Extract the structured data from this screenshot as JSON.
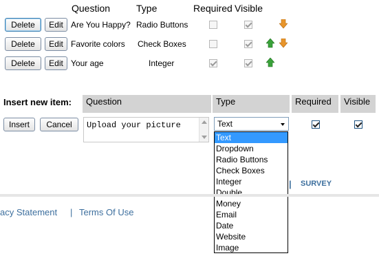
{
  "table": {
    "headers": {
      "question": "Question",
      "type": "Type",
      "required": "Required",
      "visible": "Visible"
    },
    "rows": [
      {
        "delete": "Delete",
        "edit": "Edit",
        "question": "Are You Happy?",
        "type": "Radio Buttons",
        "required": false,
        "visible": true,
        "up": false,
        "down": true
      },
      {
        "delete": "Delete",
        "edit": "Edit",
        "question": "Favorite colors",
        "type": "Check Boxes",
        "required": false,
        "visible": true,
        "up": true,
        "down": true
      },
      {
        "delete": "Delete",
        "edit": "Edit",
        "question": "Your age",
        "type": "Integer",
        "required": true,
        "visible": true,
        "up": true,
        "down": false
      }
    ]
  },
  "insert": {
    "label": "Insert new item:",
    "headers": {
      "question": "Question",
      "type": "Type",
      "required": "Required",
      "visible": "Visible"
    },
    "insert_button": "Insert",
    "cancel_button": "Cancel",
    "question_value": "Upload your picture",
    "type_selected": "Text",
    "required": true,
    "visible": true,
    "type_options": [
      "Text",
      "Dropdown",
      "Radio Buttons",
      "Check Boxes",
      "Integer",
      "Double",
      "Money",
      "Email",
      "Date",
      "Website",
      "Image"
    ]
  },
  "nav": {
    "separator": "|",
    "survey": "SURVEY"
  },
  "footer": {
    "privacy": "acy Statement",
    "separator": "|",
    "terms": "Terms Of Use"
  },
  "colors": {
    "accent_link": "#3d6f9e",
    "selected_option": "#3399ff",
    "arrow_up": "#3aa23a",
    "arrow_down": "#e8952b"
  }
}
